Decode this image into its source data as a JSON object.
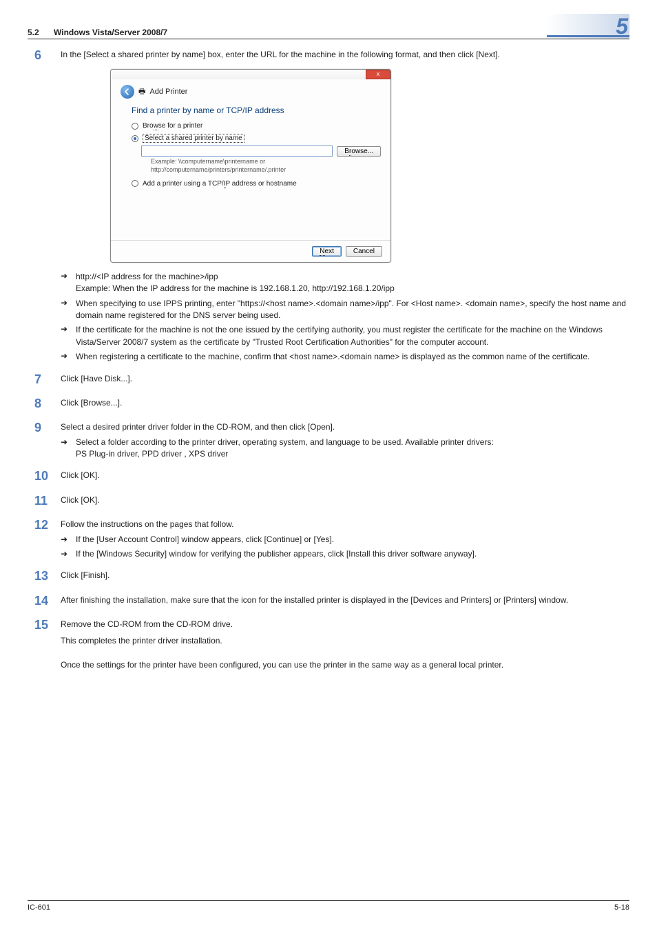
{
  "header": {
    "section_number": "5.2",
    "section_title": "Windows Vista/Server 2008/7",
    "chapter_number": "5"
  },
  "footer": {
    "left": "IC-601",
    "right": "5-18"
  },
  "arrow": "➜",
  "steps": {
    "s6": {
      "num": "6",
      "intro": "In the [Select a shared printer by name] box, enter the URL for the machine in the following format, and then click [Next].",
      "bullets": [
        {
          "t": "http://<IP address for the machine>/ipp",
          "sub": "Example: When the IP address for the machine is 192.168.1.20, http://192.168.1.20/ipp"
        },
        {
          "t": "When specifying to use IPPS printing, enter \"https://<host name>.<domain name>/ipp\". For <Host name>. <domain name>, specify the host name and domain name registered for the DNS server being used."
        },
        {
          "t": "If the certificate for the machine is not the one issued by the certifying authority, you must register the certificate for the machine on the Windows Vista/Server 2008/7 system as the certificate by \"Trusted Root Certification Authorities\" for the computer account."
        },
        {
          "t": "When registering a certificate to the machine, confirm that <host name>.<domain name> is displayed as the common name of the certificate."
        }
      ]
    },
    "s7": {
      "num": "7",
      "text": "Click [Have Disk...]."
    },
    "s8": {
      "num": "8",
      "text": "Click [Browse...]."
    },
    "s9": {
      "num": "9",
      "text": "Select a desired printer driver folder in the CD-ROM, and then click [Open].",
      "bullets": [
        {
          "t": "Select a folder according to the printer driver, operating system, and language to be used. Available printer drivers:",
          "sub": "PS Plug-in driver, PPD driver , XPS driver"
        }
      ]
    },
    "s10": {
      "num": "10",
      "text": "Click [OK]."
    },
    "s11": {
      "num": "11",
      "text": "Click [OK]."
    },
    "s12": {
      "num": "12",
      "text": "Follow the instructions on the pages that follow.",
      "bullets": [
        {
          "t": "If the [User Account Control] window appears, click [Continue] or [Yes]."
        },
        {
          "t": "If the [Windows Security] window for verifying the publisher appears, click [Install this driver software anyway]."
        }
      ]
    },
    "s13": {
      "num": "13",
      "text": "Click [Finish]."
    },
    "s14": {
      "num": "14",
      "text": "After finishing the installation, make sure that the icon for the installed printer is displayed in the [Devices and Printers] or [Printers]  window."
    },
    "s15": {
      "num": "15",
      "text": "Remove the CD-ROM from the CD-ROM drive.",
      "sub": "This completes the printer driver installation."
    }
  },
  "closing": "Once the settings for the printer have been configured, you can use the printer in the same way as a general local printer.",
  "win": {
    "title": "Add Printer",
    "heading": "Find a printer by name or TCP/IP address",
    "opt_browse_pre": "Bro",
    "opt_browse_u": "w",
    "opt_browse_post": "se for a printer",
    "opt_select_u": "S",
    "opt_select_post": "elect a shared printer by name",
    "opt_tcpip_pre": "Add a printer using a TCP/",
    "opt_tcpip_u": "I",
    "opt_tcpip_post": "P address or hostname",
    "browse_pre": "B",
    "browse_u": "r",
    "browse_post": "owse...",
    "example1": "Example: \\\\computername\\printername or",
    "example2": "http://computername/printers/printername/.printer",
    "next_u": "N",
    "next_post": "ext",
    "cancel": "Cancel",
    "close_glyph": "x",
    "back_glyph": "←",
    "printer_icon": "🖶"
  }
}
